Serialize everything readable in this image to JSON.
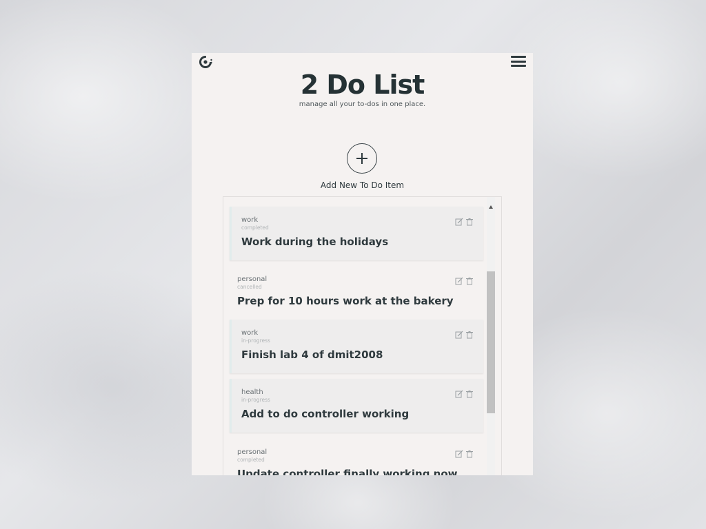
{
  "header": {
    "title": "2 Do List",
    "subtitle": "manage all your to-dos in one place."
  },
  "add": {
    "label": "Add New To Do Item",
    "icon": "plus-icon"
  },
  "todos": [
    {
      "category": "work",
      "status": "completed",
      "task": "Work during the holidays"
    },
    {
      "category": "personal",
      "status": "cancelled",
      "task": "Prep for 10 hours work at the bakery"
    },
    {
      "category": "work",
      "status": "in-progress",
      "task": "Finish lab 4 of dmit2008"
    },
    {
      "category": "health",
      "status": "in-progress",
      "task": "Add to do controller working"
    },
    {
      "category": "personal",
      "status": "completed",
      "task": "Update controller finally working now"
    }
  ],
  "colors": {
    "panel": "#f5f2f1",
    "text_dark": "#253235",
    "card": "#eeeded",
    "card_accent": "#e1ecec"
  },
  "icons": {
    "logo": "spinner-logo-icon",
    "menu": "hamburger-menu-icon",
    "edit": "edit-icon",
    "delete": "trash-icon"
  }
}
